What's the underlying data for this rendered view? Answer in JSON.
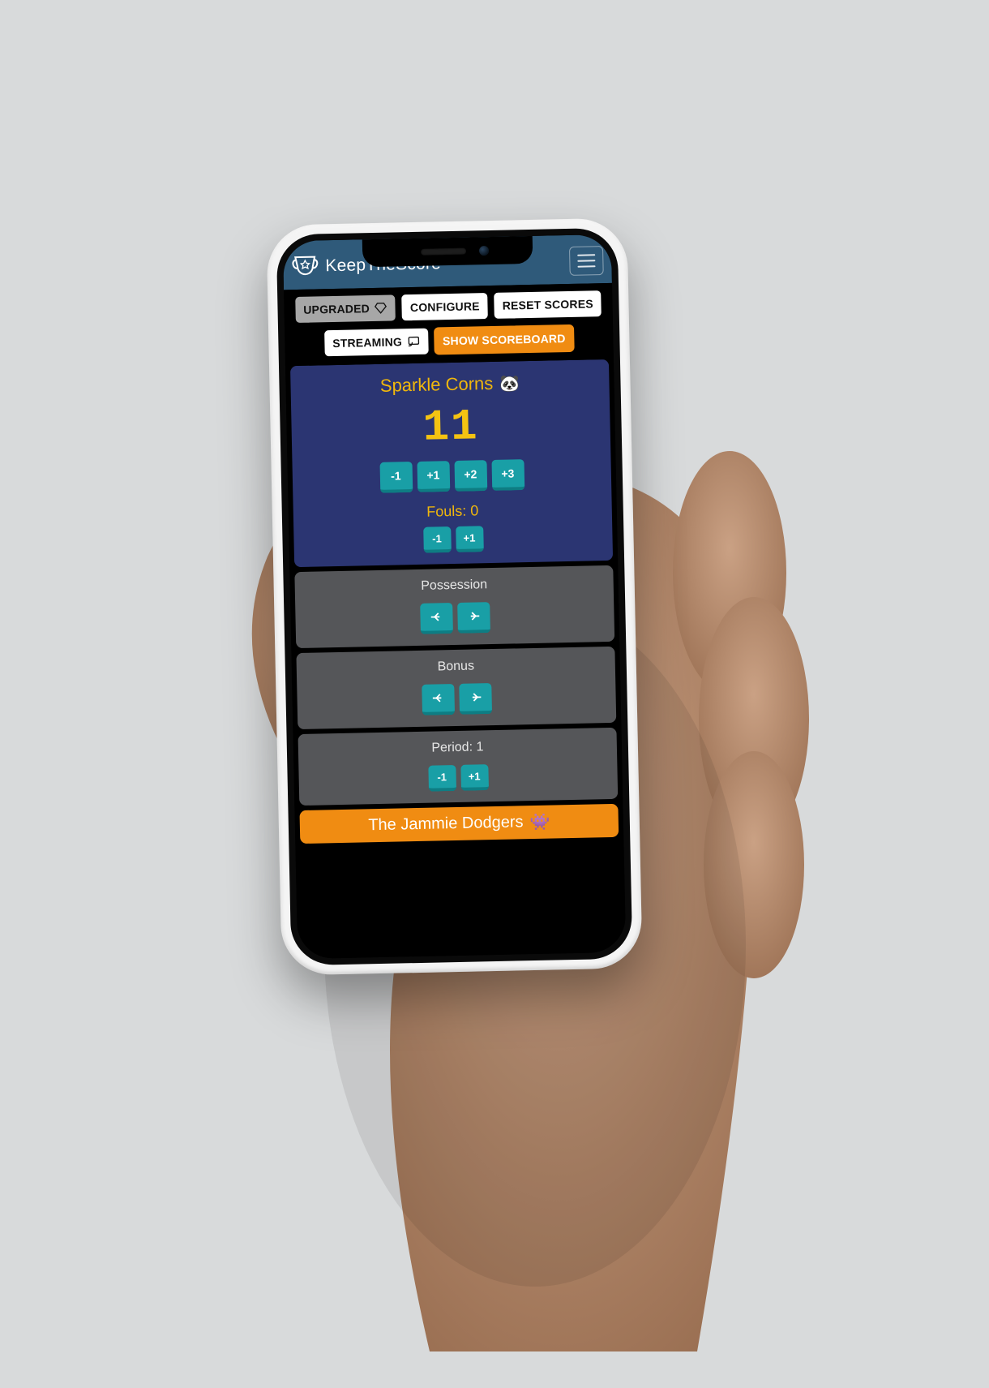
{
  "app": {
    "title": "KeepTheScore"
  },
  "toolbar": {
    "upgraded": "UPGRADED",
    "configure": "CONFIGURE",
    "reset": "RESET SCORES",
    "streaming": "STREAMING",
    "show": "SHOW SCOREBOARD"
  },
  "team1": {
    "name": "Sparkle Corns",
    "emoji": "🐼",
    "score": "11",
    "score_buttons": [
      "-1",
      "+1",
      "+2",
      "+3"
    ],
    "fouls_label": "Fouls: 0",
    "fouls_buttons": [
      "-1",
      "+1"
    ]
  },
  "possession": {
    "label": "Possession"
  },
  "bonus": {
    "label": "Bonus"
  },
  "period": {
    "label": "Period: 1",
    "buttons": [
      "-1",
      "+1"
    ]
  },
  "team2": {
    "name": "The Jammie Dodgers",
    "emoji": "👾"
  }
}
